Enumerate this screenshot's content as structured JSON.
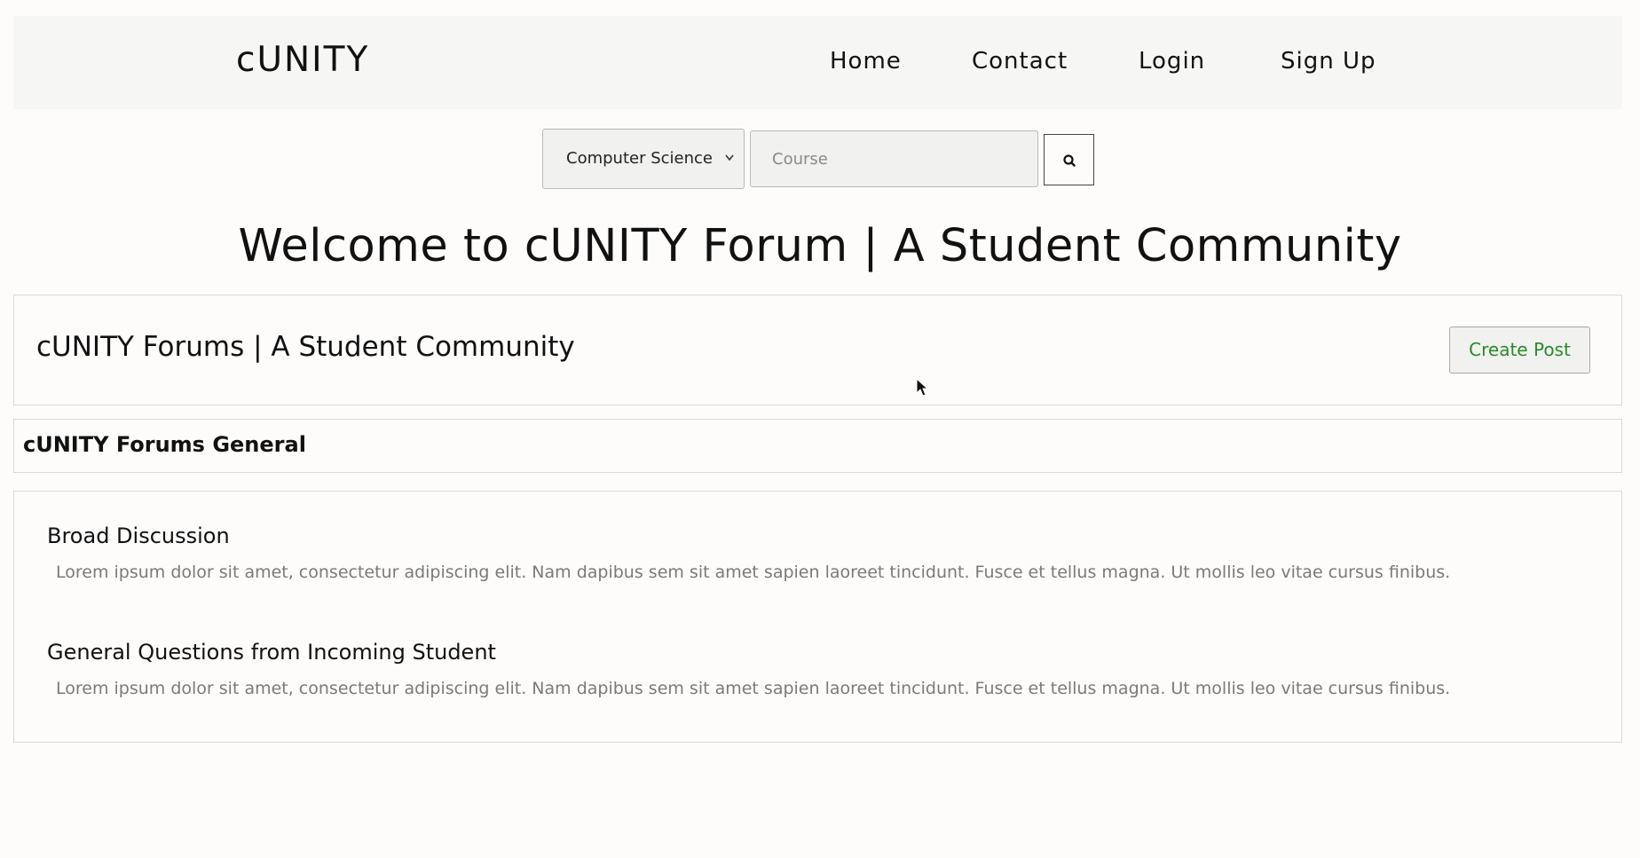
{
  "navbar": {
    "brand": "cUNITY",
    "links": [
      "Home",
      "Contact",
      "Login",
      "Sign Up"
    ]
  },
  "search": {
    "selected_department": "Computer Science",
    "course_placeholder": "Course",
    "course_value": "",
    "button_icon": "search-icon"
  },
  "welcome_heading": "Welcome to cUNITY Forum | A Student Community",
  "forum_header": {
    "title": "cUNITY Forums | A Student Community",
    "create_post_label": "Create Post"
  },
  "general_section": {
    "title": "cUNITY Forums General"
  },
  "topics": [
    {
      "title": "Broad Discussion",
      "description": "Lorem ipsum dolor sit amet, consectetur adipiscing elit. Nam dapibus sem sit amet sapien laoreet tincidunt. Fusce et tellus magna. Ut mollis leo vitae cursus finibus."
    },
    {
      "title": "General Questions from Incoming Student",
      "description": "Lorem ipsum dolor sit amet, consectetur adipiscing elit. Nam dapibus sem sit amet sapien laoreet tincidunt. Fusce et tellus magna. Ut mollis leo vitae cursus finibus."
    }
  ],
  "colors": {
    "navbar_bg": "#f6f6f5",
    "page_bg": "#fdfcfb",
    "create_post_text": "#2a8a2a",
    "description_text": "#7a7a7a"
  }
}
